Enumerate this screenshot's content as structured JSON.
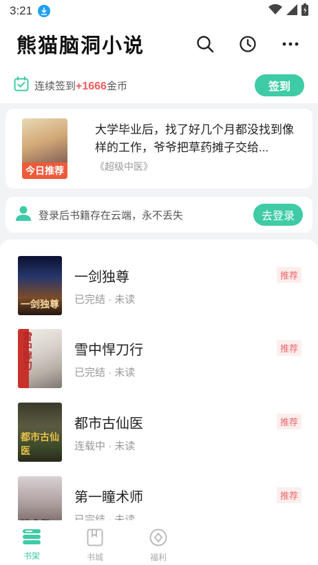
{
  "status_bar": {
    "time": "3:21"
  },
  "header": {
    "title": "熊猫脑洞小说",
    "icons": [
      "search-icon",
      "history-icon",
      "more-icon"
    ]
  },
  "signin": {
    "prefix": "连续签到",
    "amount": "+1666",
    "suffix": "金币",
    "button": "签到"
  },
  "recommend": {
    "badge": "今日推荐",
    "description": "大学毕业后，找了好几个月都没找到像样的工作，爷爷把草药摊子交给...",
    "book": "《超级中医》"
  },
  "login_prompt": {
    "text": "登录后书籍存在云端，永不丢失",
    "button": "去登录"
  },
  "books": [
    {
      "title": "一剑独尊",
      "meta": "已完结 · 未读",
      "tag": "推荐",
      "cover_text": "一剑独尊"
    },
    {
      "title": "雪中悍刀行",
      "meta": "已完结 · 未读",
      "tag": "推荐",
      "cover_text": "雪中悍刀"
    },
    {
      "title": "都市古仙医",
      "meta": "连载中 · 未读",
      "tag": "推荐",
      "cover_text": "都市古仙医"
    },
    {
      "title": "第一瞳术师",
      "meta": "已完结 · 未读",
      "tag": "推荐",
      "cover_text": "瞳术师"
    }
  ],
  "bottom_nav": [
    {
      "label": "书架",
      "active": true
    },
    {
      "label": "书城",
      "active": false
    },
    {
      "label": "福利",
      "active": false
    }
  ],
  "colors": {
    "accent": "#3ecba6",
    "gold": "#f05a5a",
    "badge": "#ef5a3a",
    "tag": "#e86a6a"
  }
}
